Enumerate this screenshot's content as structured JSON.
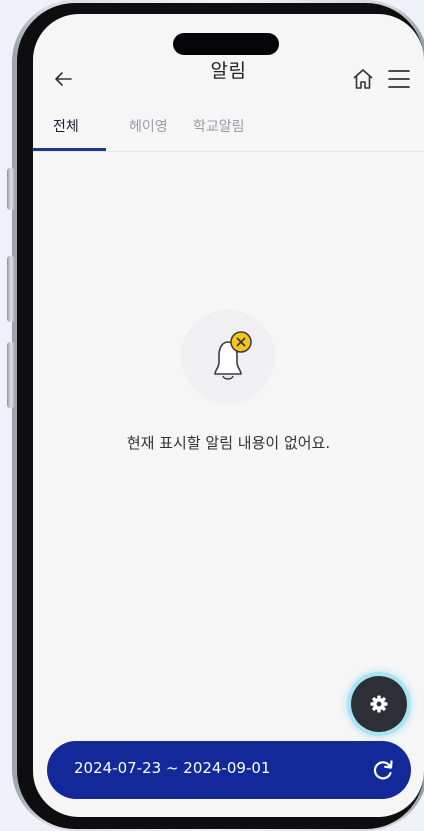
{
  "header": {
    "title": "알림",
    "back_icon": "arrow-left-icon",
    "home_icon": "home-icon",
    "menu_icon": "hamburger-menu-icon"
  },
  "tabs": [
    {
      "label": "전체",
      "active": true
    },
    {
      "label": "헤이영",
      "active": false
    },
    {
      "label": "학교알림",
      "active": false
    }
  ],
  "empty_state": {
    "icon": "bell-with-x-icon",
    "message": "현재 표시할 알림 내용이 없어요."
  },
  "fab": {
    "icon": "gear-icon"
  },
  "date_range": {
    "text": "2024-07-23 ~ 2024-09-01",
    "refresh_icon": "refresh-icon"
  },
  "colors": {
    "accent": "#1d3a8a",
    "date_bar": "#13299a",
    "badge": "#f5c518",
    "fab": "#2c2f35",
    "fab_glow": "#a9e4f4"
  }
}
